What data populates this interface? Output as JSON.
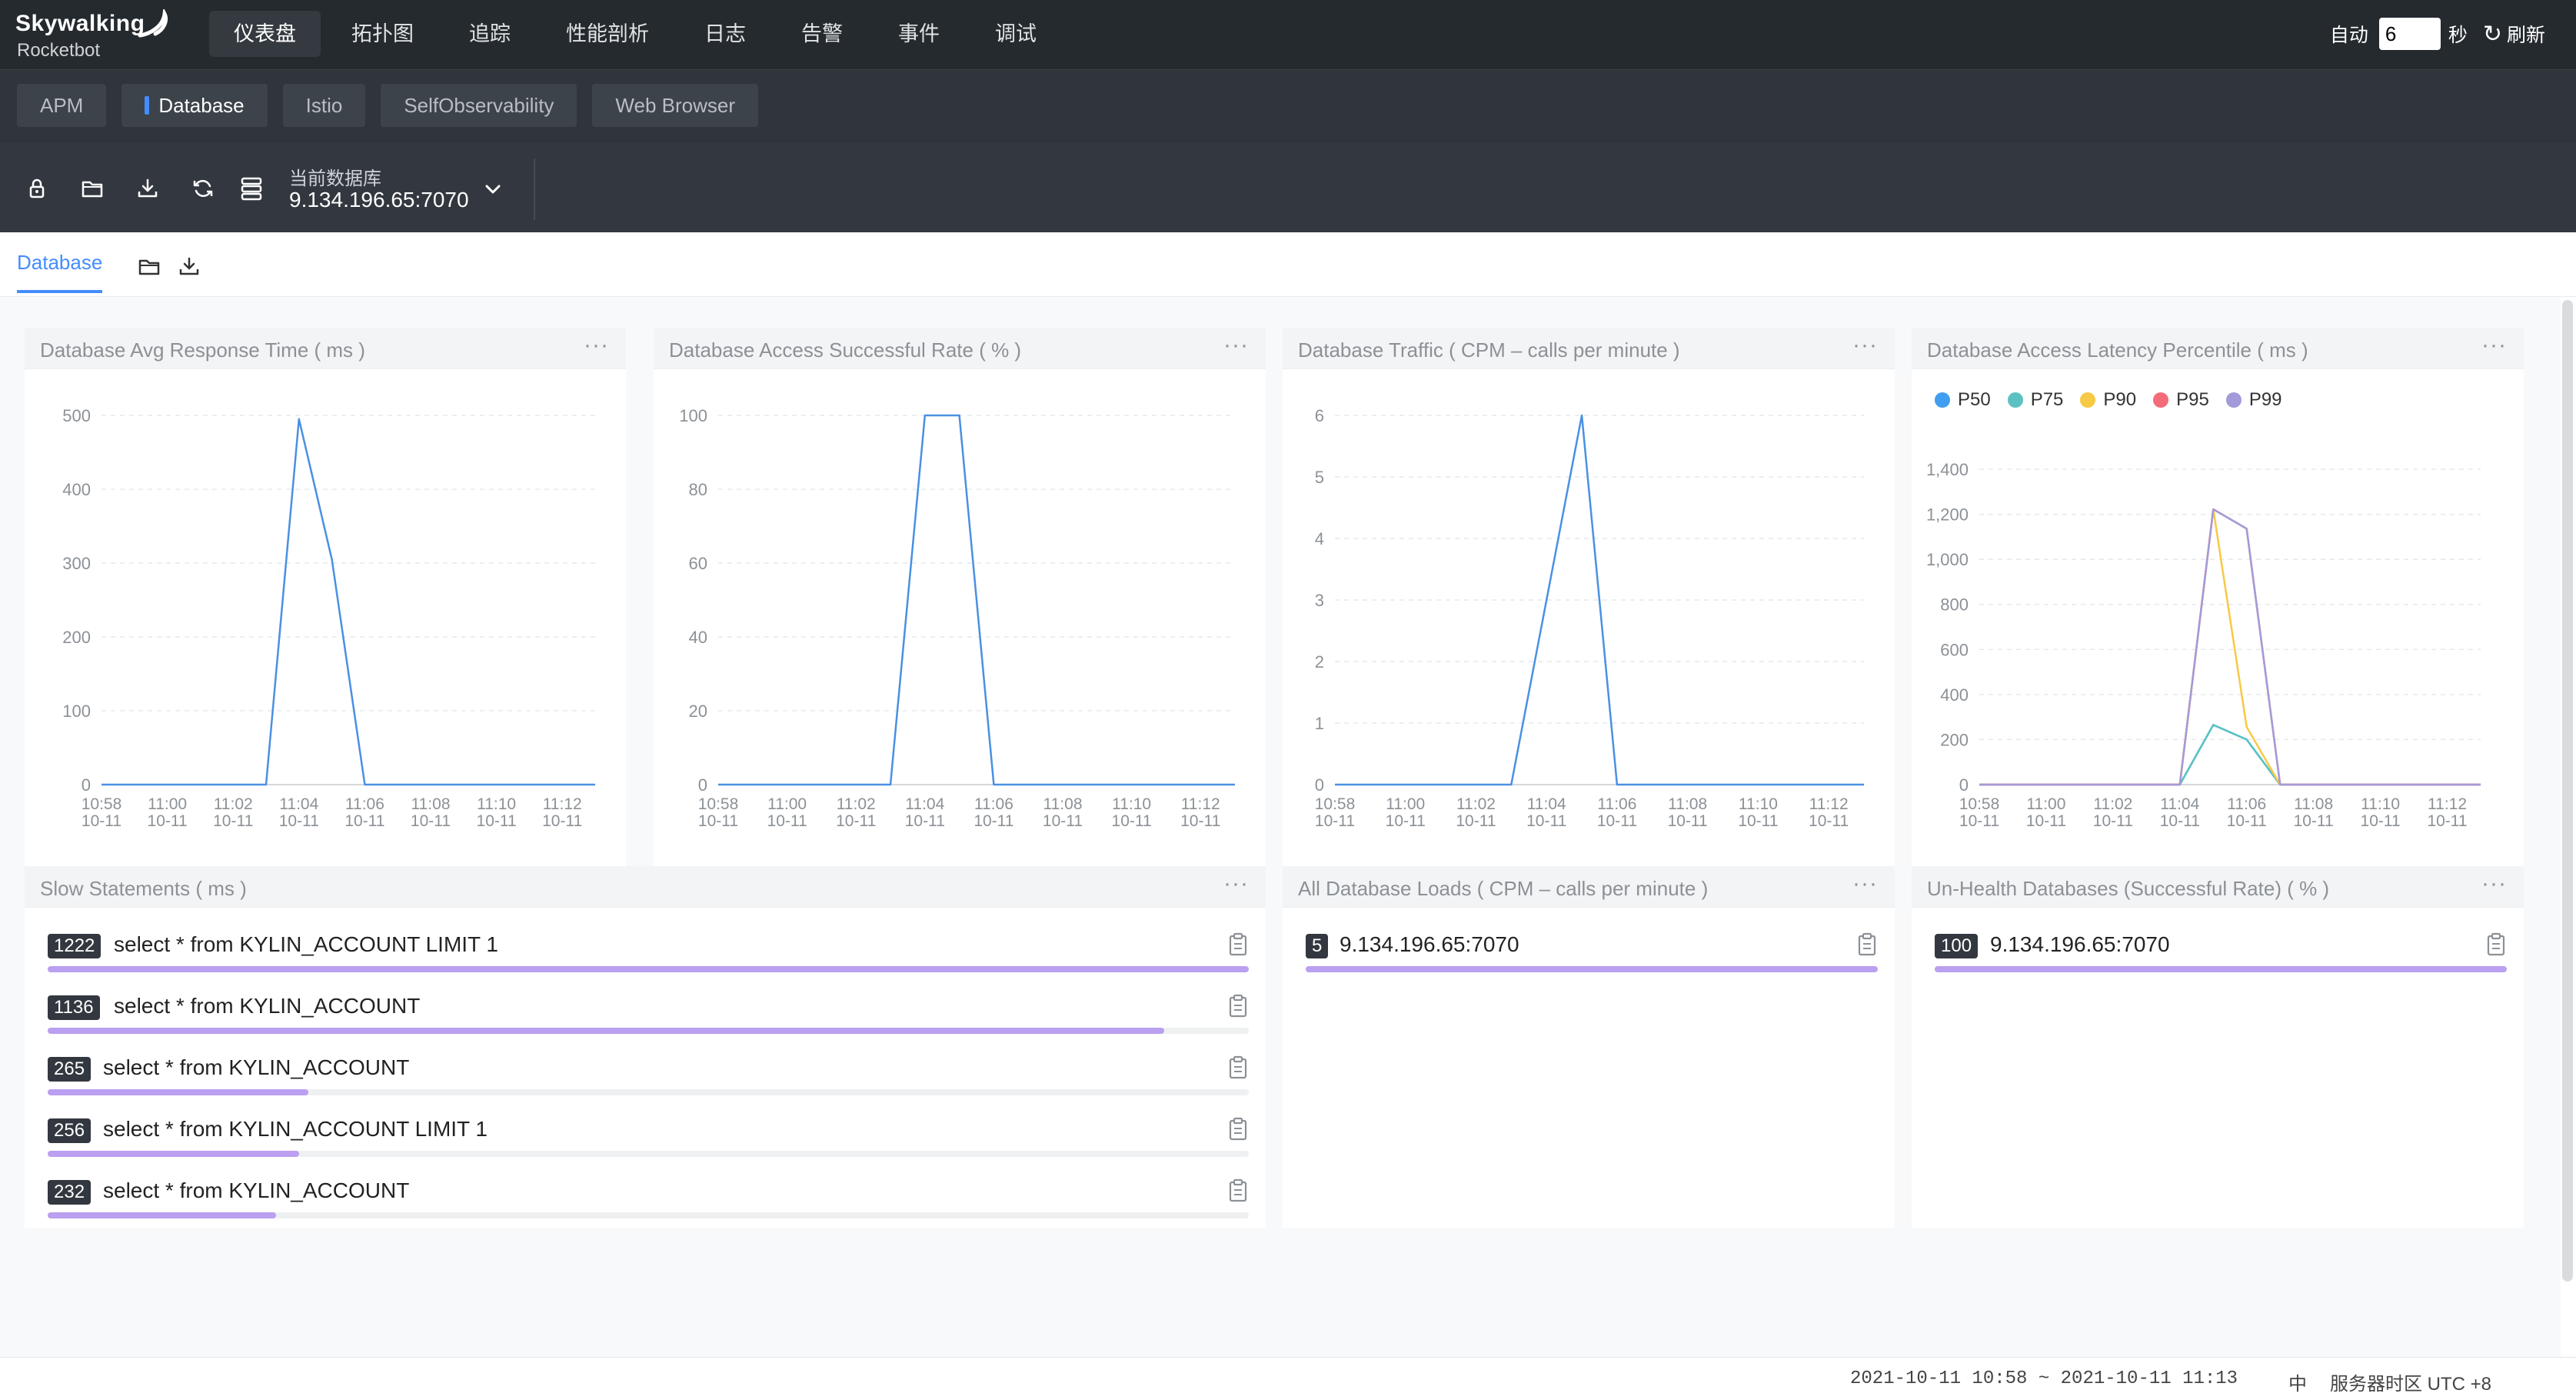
{
  "app": {
    "brand": "Skywalking",
    "sub_brand": "Rocketbot"
  },
  "nav": {
    "items": [
      {
        "label": "仪表盘",
        "active": true
      },
      {
        "label": "拓扑图"
      },
      {
        "label": "追踪"
      },
      {
        "label": "性能剖析"
      },
      {
        "label": "日志"
      },
      {
        "label": "告警"
      },
      {
        "label": "事件"
      },
      {
        "label": "调试"
      }
    ]
  },
  "auto_refresh": {
    "label": "自动",
    "value": "6",
    "unit": "秒",
    "refresh_label": "刷新"
  },
  "templates": [
    {
      "label": "APM"
    },
    {
      "label": "Database",
      "active": true
    },
    {
      "label": "Istio"
    },
    {
      "label": "SelfObservability"
    },
    {
      "label": "Web Browser"
    }
  ],
  "selector": {
    "caption": "当前数据库",
    "value": "9.134.196.65:7070"
  },
  "dashboard_tab": {
    "label": "Database"
  },
  "time_ticks": [
    {
      "time": "10:58",
      "date": "10-11"
    },
    {
      "time": "11:00",
      "date": "10-11"
    },
    {
      "time": "11:02",
      "date": "10-11"
    },
    {
      "time": "11:04",
      "date": "10-11"
    },
    {
      "time": "11:06",
      "date": "10-11"
    },
    {
      "time": "11:08",
      "date": "10-11"
    },
    {
      "time": "11:10",
      "date": "10-11"
    },
    {
      "time": "11:12",
      "date": "10-11"
    }
  ],
  "chart_data": [
    {
      "type": "line",
      "title": "Database Avg Response Time ( ms )",
      "x": [
        "10:58",
        "10:59",
        "11:00",
        "11:01",
        "11:02",
        "11:03",
        "11:04",
        "11:05",
        "11:06",
        "11:07",
        "11:08",
        "11:09",
        "11:10",
        "11:11",
        "11:12",
        "11:13"
      ],
      "series": [
        {
          "values": [
            0,
            0,
            0,
            0,
            0,
            0,
            495,
            305,
            0,
            0,
            0,
            0,
            0,
            0,
            0,
            0
          ],
          "color": "#4a90e2"
        }
      ],
      "ylim": [
        0,
        500
      ],
      "yticks": [
        "0",
        "100",
        "200",
        "300",
        "400",
        "500"
      ]
    },
    {
      "type": "line",
      "title": "Database Access Successful Rate ( % )",
      "x": [
        "10:58",
        "10:59",
        "11:00",
        "11:01",
        "11:02",
        "11:03",
        "11:04",
        "11:05",
        "11:06",
        "11:07",
        "11:08",
        "11:09",
        "11:10",
        "11:11",
        "11:12",
        "11:13"
      ],
      "series": [
        {
          "values": [
            0,
            0,
            0,
            0,
            0,
            0,
            100,
            100,
            0,
            0,
            0,
            0,
            0,
            0,
            0,
            0
          ],
          "color": "#4a90e2"
        }
      ],
      "ylim": [
        0,
        100
      ],
      "yticks": [
        "0",
        "20",
        "40",
        "60",
        "80",
        "100"
      ]
    },
    {
      "type": "line",
      "title": "Database Traffic ( CPM – calls per minute )",
      "x": [
        "10:58",
        "10:59",
        "11:00",
        "11:01",
        "11:02",
        "11:03",
        "11:04",
        "11:05",
        "11:06",
        "11:07",
        "11:08",
        "11:09",
        "11:10",
        "11:11",
        "11:12",
        "11:13"
      ],
      "series": [
        {
          "values": [
            0,
            0,
            0,
            0,
            0,
            0,
            3,
            6,
            0,
            0,
            0,
            0,
            0,
            0,
            0,
            0
          ],
          "color": "#4a90e2"
        }
      ],
      "ylim": [
        0,
        6
      ],
      "yticks": [
        "0",
        "1",
        "2",
        "3",
        "4",
        "5",
        "6"
      ]
    },
    {
      "type": "line",
      "title": "Database Access Latency Percentile ( ms )",
      "x": [
        "10:58",
        "10:59",
        "11:00",
        "11:01",
        "11:02",
        "11:03",
        "11:04",
        "11:05",
        "11:06",
        "11:07",
        "11:08",
        "11:09",
        "11:10",
        "11:11",
        "11:12",
        "11:13"
      ],
      "series": [
        {
          "name": "P50",
          "color": "#3f9ef0",
          "values": [
            0,
            0,
            0,
            0,
            0,
            0,
            0,
            265,
            200,
            0,
            0,
            0,
            0,
            0,
            0,
            0
          ]
        },
        {
          "name": "P75",
          "color": "#5bc2c1",
          "values": [
            0,
            0,
            0,
            0,
            0,
            0,
            0,
            265,
            200,
            0,
            0,
            0,
            0,
            0,
            0,
            0
          ]
        },
        {
          "name": "P90",
          "color": "#f7c944",
          "values": [
            0,
            0,
            0,
            0,
            0,
            0,
            0,
            1222,
            256,
            0,
            0,
            0,
            0,
            0,
            0,
            0
          ]
        },
        {
          "name": "P95",
          "color": "#f46b79",
          "values": [
            0,
            0,
            0,
            0,
            0,
            0,
            0,
            1222,
            1136,
            0,
            0,
            0,
            0,
            0,
            0,
            0
          ]
        },
        {
          "name": "P99",
          "color": "#a39ad9",
          "values": [
            0,
            0,
            0,
            0,
            0,
            0,
            0,
            1222,
            1136,
            0,
            0,
            0,
            0,
            0,
            0,
            0
          ]
        }
      ],
      "ylim": [
        0,
        1400
      ],
      "yticks": [
        "0",
        "200",
        "400",
        "600",
        "800",
        "1,000",
        "1,200",
        "1,400"
      ],
      "legend": "top-left"
    }
  ],
  "slow_statements": {
    "title": "Slow Statements ( ms )",
    "max": 1222,
    "items": [
      {
        "value": 1222,
        "label": "1222",
        "text": "select * from KYLIN_ACCOUNT LIMIT 1"
      },
      {
        "value": 1136,
        "label": "1136",
        "text": "select * from KYLIN_ACCOUNT"
      },
      {
        "value": 265,
        "label": "265",
        "text": "select * from KYLIN_ACCOUNT"
      },
      {
        "value": 256,
        "label": "256",
        "text": "select * from KYLIN_ACCOUNT LIMIT 1"
      },
      {
        "value": 232,
        "label": "232",
        "text": "select * from KYLIN_ACCOUNT"
      }
    ]
  },
  "db_loads": {
    "title": "All Database Loads ( CPM – calls per minute )",
    "max": 5,
    "items": [
      {
        "value": 5,
        "label": "5",
        "text": "9.134.196.65:7070"
      }
    ]
  },
  "unhealth": {
    "title": "Un-Health Databases (Successful Rate) ( % )",
    "max": 100,
    "items": [
      {
        "value": 100,
        "label": "100",
        "text": "9.134.196.65:7070"
      }
    ]
  },
  "footer": {
    "time_range": "2021-10-11 10:58 ~ 2021-10-11 11:13",
    "lang": "中",
    "timezone": "服务器时区 UTC +8"
  },
  "colors": {
    "accent": "#448dfe",
    "bar": "#bb9ff0",
    "line": "#4a90e2"
  }
}
